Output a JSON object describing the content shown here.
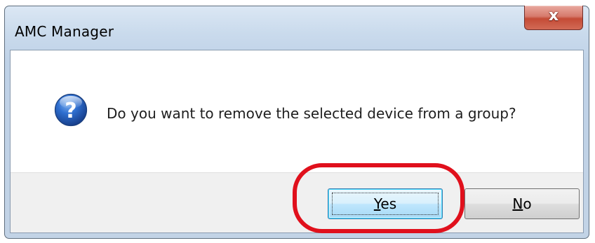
{
  "window": {
    "title": "AMC Manager",
    "close_glyph": "x"
  },
  "dialog": {
    "icon": "question-icon",
    "message": "Do you want to remove the selected device from a group?"
  },
  "buttons": {
    "yes": {
      "label": "Yes",
      "mnemonic": "Y",
      "rest": "es"
    },
    "no": {
      "label": "No",
      "mnemonic": "N",
      "rest": "o"
    }
  },
  "annotation": {
    "highlight_color": "#e0101c",
    "target": "yes-button"
  },
  "colors": {
    "focused_button_border": "#3c7fb1",
    "close_button": "#c44b36"
  }
}
